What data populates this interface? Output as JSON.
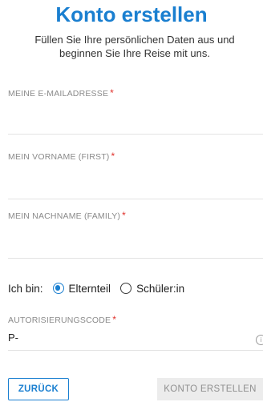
{
  "header": {
    "title": "Konto erstellen",
    "subtitle": "Füllen Sie Ihre persönlichen Daten aus und beginnen Sie Ihre Reise mit uns."
  },
  "form": {
    "email": {
      "label": "MEINE E-MAILADRESSE",
      "value": "",
      "required_mark": "*"
    },
    "first_name": {
      "label": "MEIN VORNAME (FIRST)",
      "value": "",
      "required_mark": "*"
    },
    "last_name": {
      "label": "MEIN NACHNAME (FAMILY)",
      "value": "",
      "required_mark": "*"
    },
    "role": {
      "label": "Ich bin:",
      "options": [
        {
          "label": "Elternteil",
          "selected": true
        },
        {
          "label": "Schüler:in",
          "selected": false
        }
      ]
    },
    "auth_code": {
      "label": "AUTORISIERUNGSCODE",
      "value": "P-",
      "required_mark": "*",
      "info_icon": "info-icon"
    }
  },
  "buttons": {
    "back": "ZURÜCK",
    "create": "KONTO ERSTELLEN"
  },
  "colors": {
    "accent": "#1a7fd0",
    "required": "#e0312b",
    "disabled_bg": "#ececec",
    "disabled_text": "#8f8f8f"
  }
}
